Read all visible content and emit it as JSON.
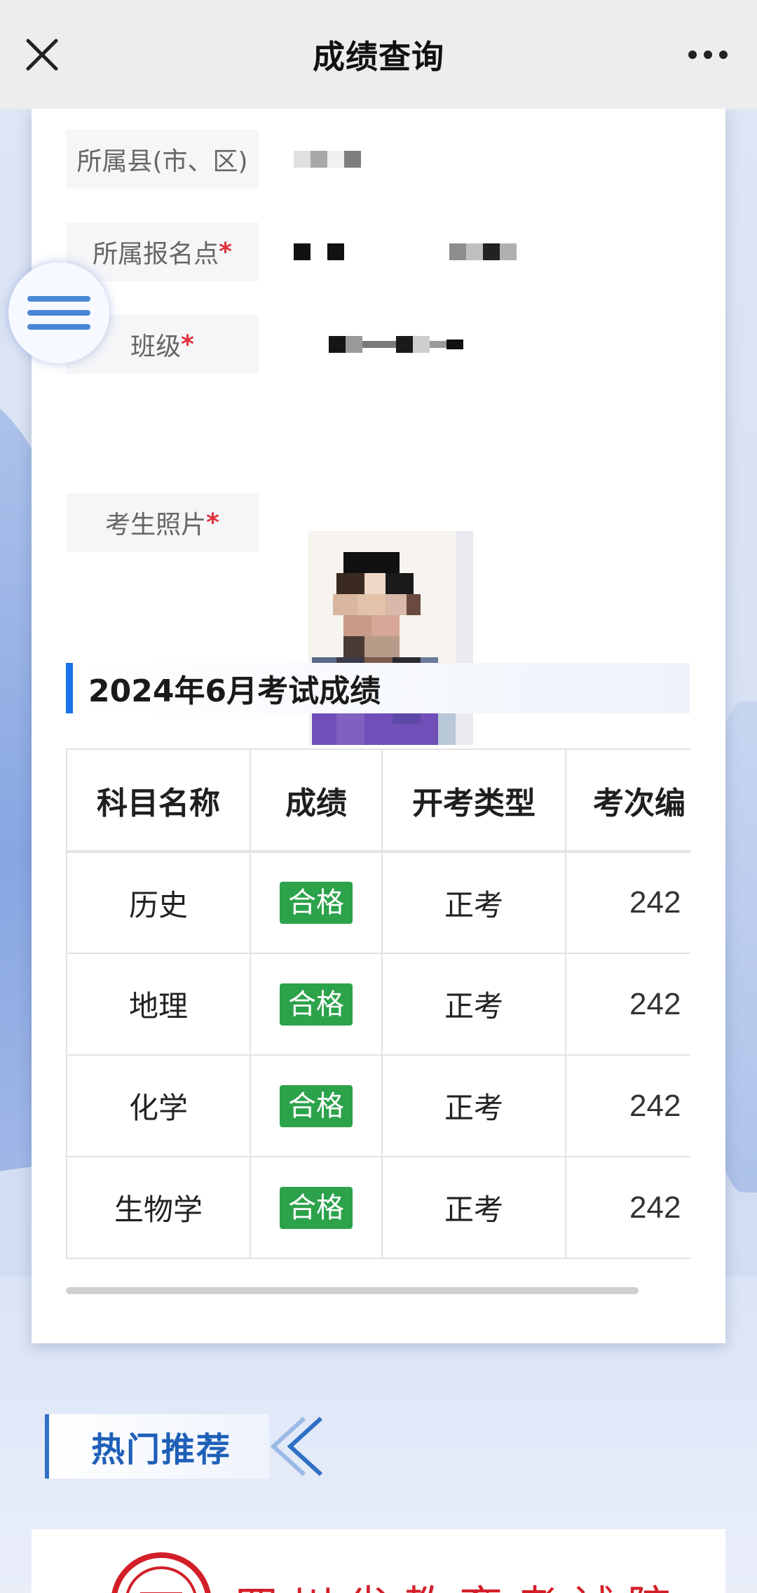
{
  "navbar": {
    "title": "成绩查询",
    "close_icon": "close-icon",
    "more_icon": "more-dots-icon"
  },
  "form": {
    "rows": [
      {
        "label": "所属县(市、区)",
        "required": true
      },
      {
        "label": "所属报名点",
        "required": true
      },
      {
        "label": "班级",
        "required": true
      },
      {
        "label": "考生照片",
        "required": true
      }
    ],
    "required_mark": "*"
  },
  "section": {
    "title": "2024年6月考试成绩"
  },
  "table": {
    "headers": [
      "科目名称",
      "成绩",
      "开考类型",
      "考次编"
    ],
    "rows": [
      {
        "subject": "历史",
        "result": "合格",
        "exam_type": "正考",
        "code": "242"
      },
      {
        "subject": "地理",
        "result": "合格",
        "exam_type": "正考",
        "code": "242"
      },
      {
        "subject": "化学",
        "result": "合格",
        "exam_type": "正考",
        "code": "242"
      },
      {
        "subject": "生物学",
        "result": "合格",
        "exam_type": "正考",
        "code": "242"
      }
    ]
  },
  "hot": {
    "title": "热门推荐"
  },
  "banner": {
    "org_name": "四川省教育考试院"
  },
  "colors": {
    "accent": "#1a73e8",
    "pass_badge": "#2ca24a",
    "required": "#e2303b",
    "org_red": "#d21f28"
  }
}
